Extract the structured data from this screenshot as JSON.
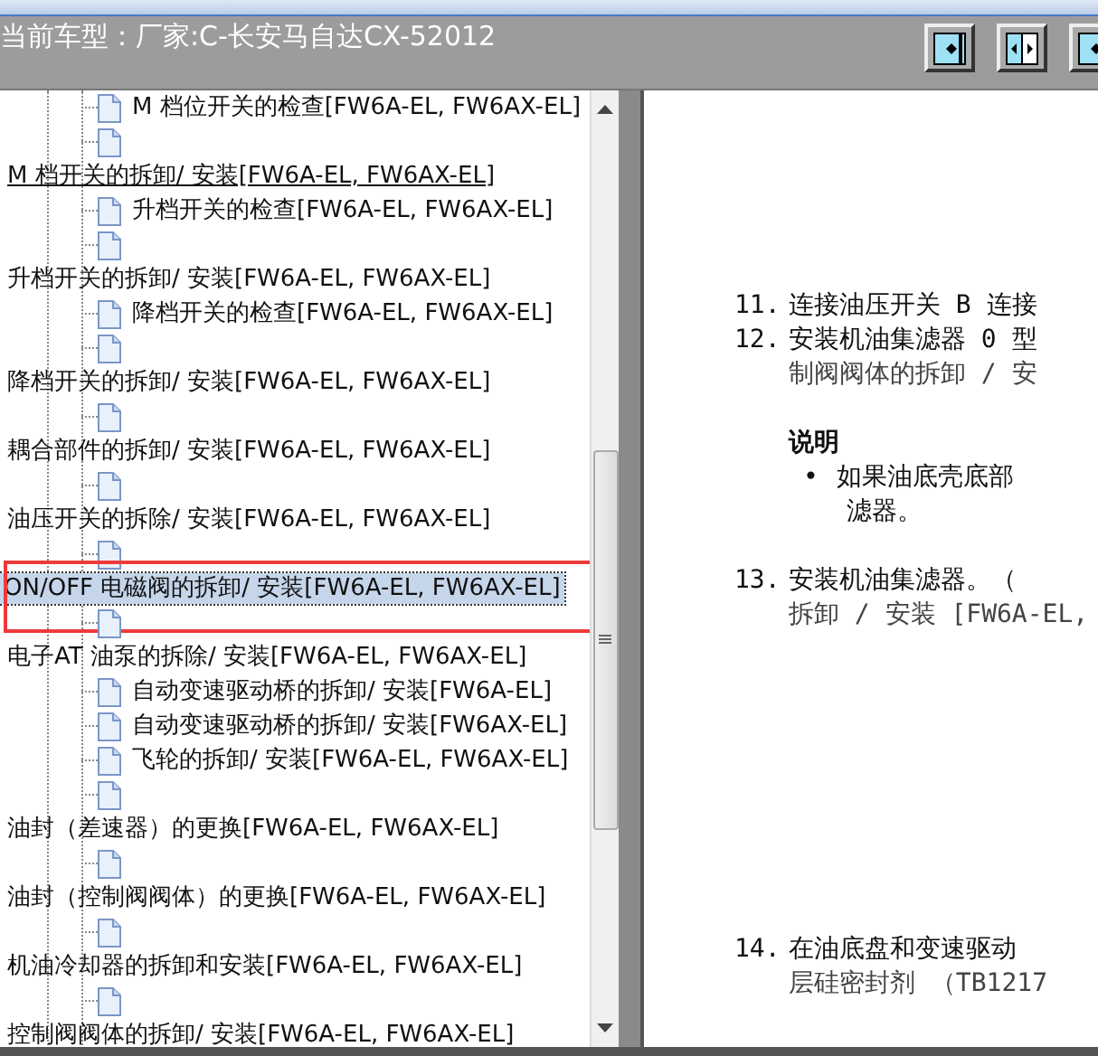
{
  "header": {
    "title": "当前车型：厂家:C-长安马自达CX-52012",
    "buttons": [
      {
        "kind": "single"
      },
      {
        "kind": "split"
      },
      {
        "kind": "single"
      }
    ]
  },
  "tree": [
    {
      "children": [
        {
          "kind": "page",
          "label": "M 档位开关的检查[FW6A-EL, FW6AX-EL]"
        },
        {
          "kind": "page"
        }
      ]
    },
    {
      "label": "M 档开关的拆卸/ 安装[FW6A-EL, FW6AX-EL]",
      "selected": false,
      "hovered": true,
      "highlighted": false,
      "children": [
        {
          "kind": "page",
          "label": "升档开关的检查[FW6A-EL, FW6AX-EL]"
        },
        {
          "kind": "page"
        }
      ]
    },
    {
      "label": "升档开关的拆卸/ 安装[FW6A-EL, FW6AX-EL]",
      "selected": false,
      "hovered": false,
      "highlighted": false,
      "children": [
        {
          "kind": "page",
          "label": "降档开关的检查[FW6A-EL, FW6AX-EL]"
        },
        {
          "kind": "page"
        }
      ]
    },
    {
      "label": "降档开关的拆卸/ 安装[FW6A-EL, FW6AX-EL]",
      "selected": false,
      "hovered": false,
      "highlighted": false,
      "children": [
        {
          "kind": "page"
        }
      ]
    },
    {
      "label": "耦合部件的拆卸/ 安装[FW6A-EL, FW6AX-EL]",
      "selected": false,
      "hovered": false,
      "highlighted": false,
      "children": [
        {
          "kind": "page"
        }
      ]
    },
    {
      "label": "油压开关的拆除/ 安装[FW6A-EL, FW6AX-EL]",
      "selected": false,
      "hovered": false,
      "highlighted": false,
      "children": [
        {
          "kind": "page"
        }
      ]
    },
    {
      "label": "ON/OFF 电磁阀的拆卸/ 安装[FW6A-EL, FW6AX-EL]",
      "selected": true,
      "hovered": false,
      "highlighted": true,
      "children": [
        {
          "kind": "page"
        }
      ]
    },
    {
      "label": "电子AT 油泵的拆除/ 安装[FW6A-EL, FW6AX-EL]",
      "selected": false,
      "hovered": false,
      "highlighted": false,
      "children": [
        {
          "kind": "page",
          "label": "自动变速驱动桥的拆卸/ 安装[FW6A-EL]"
        },
        {
          "kind": "page",
          "label": "自动变速驱动桥的拆卸/ 安装[FW6AX-EL]"
        },
        {
          "kind": "page",
          "label": "飞轮的拆卸/ 安装[FW6A-EL, FW6AX-EL]"
        },
        {
          "kind": "page"
        }
      ]
    },
    {
      "label": "油封（差速器）的更换[FW6A-EL, FW6AX-EL]",
      "selected": false,
      "hovered": false,
      "highlighted": false,
      "children": [
        {
          "kind": "page"
        }
      ]
    },
    {
      "label": "油封（控制阀阀体）的更换[FW6A-EL, FW6AX-EL]",
      "selected": false,
      "hovered": false,
      "highlighted": false,
      "children": [
        {
          "kind": "page"
        }
      ]
    },
    {
      "label": "机油冷却器的拆卸和安装[FW6A-EL, FW6AX-EL]",
      "selected": false,
      "hovered": false,
      "highlighted": false,
      "children": [
        {
          "kind": "page"
        }
      ]
    },
    {
      "label": "控制阀阀体的拆卸/ 安装[FW6A-EL, FW6AX-EL]",
      "selected": false,
      "hovered": false,
      "highlighted": false
    }
  ],
  "document": [
    {
      "kind": "step",
      "number": "11.",
      "text": "连接油压开关 B 连接"
    },
    {
      "kind": "step",
      "number": "12.",
      "text": "安装机油集滤器 0 型"
    },
    {
      "kind": "cont",
      "text": "制阀阀体的拆卸 / 安"
    },
    {
      "kind": "gap"
    },
    {
      "kind": "note",
      "text": "说明"
    },
    {
      "kind": "bullet",
      "mark": "•",
      "text": "如果油底壳底部"
    },
    {
      "kind": "bulletcont",
      "text": "滤器。"
    },
    {
      "kind": "gap"
    },
    {
      "kind": "step",
      "number": "13.",
      "text": "安装机油集滤器。（"
    },
    {
      "kind": "cont",
      "text": "拆卸 / 安装 [FW6A-EL,"
    },
    {
      "kind": "biggap"
    },
    {
      "kind": "step",
      "number": "14.",
      "text": "在油底盘和变速驱动"
    },
    {
      "kind": "cont",
      "text": "层硅密封剂 （TB1217"
    }
  ]
}
